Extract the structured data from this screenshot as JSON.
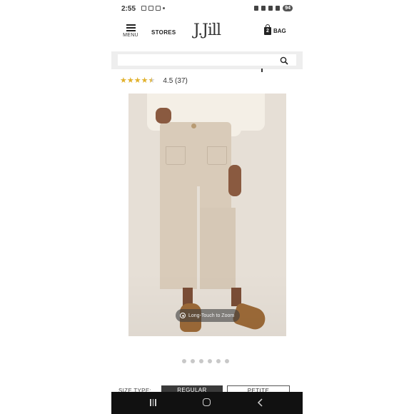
{
  "status_bar": {
    "time": "2:55",
    "battery": "94"
  },
  "header": {
    "menu_label": "MENU",
    "stores_label": "STORES",
    "logo_text": "J.Jill",
    "bag_label": "BAG",
    "bag_count": "2"
  },
  "search": {
    "value": "",
    "placeholder": ""
  },
  "rating": {
    "stars": 4.5,
    "text": "4.5 (37)"
  },
  "product_image": {
    "zoom_hint": "Long-Touch to Zoom",
    "image_count": 6,
    "active_index": 0
  },
  "size_type": {
    "label": "SIZE TYPE:",
    "options": [
      "REGULAR",
      "PETITE"
    ],
    "selected": "REGULAR"
  },
  "colors": {
    "accent_star": "#e1b12c",
    "image_background": "#e6dfd6",
    "pants": "#d9cbb9",
    "navbar": "#111111"
  },
  "icons": [
    "menu-icon",
    "bag-icon",
    "search-icon",
    "zoom-icon",
    "recents-icon",
    "home-icon",
    "back-icon"
  ]
}
